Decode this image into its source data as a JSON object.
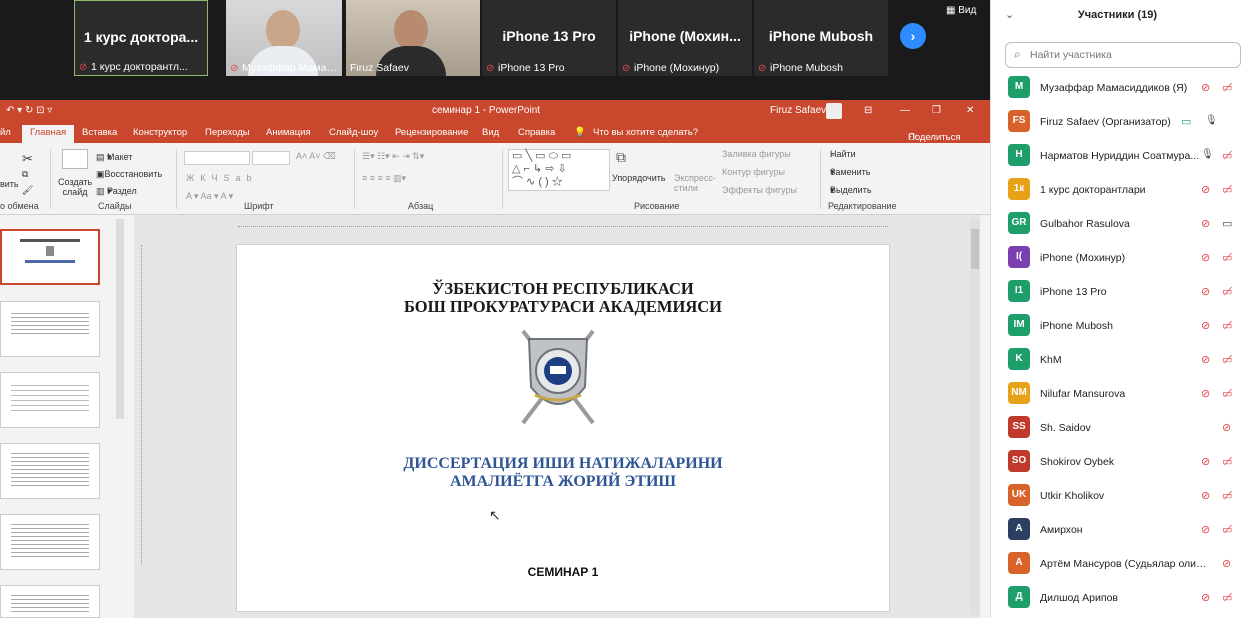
{
  "video_tiles": [
    {
      "big": "1 курс доктора...",
      "caption": "1 курс докторантл..."
    },
    {
      "big": "",
      "caption": "Музаффар Мамасидд..."
    },
    {
      "big": "",
      "caption": "Firuz Safaev"
    },
    {
      "big": "iPhone 13 Pro",
      "caption": "iPhone 13 Pro"
    },
    {
      "big": "iPhone (Мохин...",
      "caption": "iPhone (Мохинур)"
    },
    {
      "big": "iPhone Mubosh",
      "caption": "iPhone Mubosh"
    }
  ],
  "view_label": "Вид",
  "ppt": {
    "title": "семинар 1 - PowerPoint",
    "user": "Firuz Safaev",
    "tabs": [
      "йл",
      "Главная",
      "Вставка",
      "Конструктор",
      "Переходы",
      "Анимация",
      "Слайд-шоу",
      "Рецензирование",
      "Вид",
      "Справка",
      "Что вы хотите сделать?"
    ],
    "share": "Поделиться",
    "ribbon": {
      "maket": "Макет",
      "vosst": "Восстановить",
      "razdel": "Раздел",
      "create": "Создать слайд",
      "arrange": "Упорядочить",
      "express": "Экспресс-стили",
      "fill": "Заливка фигуры",
      "outline": "Контур фигуры",
      "effects": "Эффекты фигуры",
      "find": "Найти",
      "replace": "Заменить",
      "select": "Выделить",
      "vit": "вить",
      "groups": [
        "о обмена",
        "Слайды",
        "Шрифт",
        "Абзац",
        "Рисование",
        "Редактирование"
      ]
    },
    "slide": {
      "line1": "ЎЗБЕКИСТОН РЕСПУБЛИКАСИ",
      "line2": "БОШ ПРОКУРАТУРАСИ АКАДЕМИЯСИ",
      "blue1": "ДИССЕРТАЦИЯ ИШИ НАТИЖАЛАРИНИ",
      "blue2": "АМАЛИЁТГА ЖОРИЙ ЭТИШ",
      "seminar": "СЕМИНАР 1"
    }
  },
  "participants": {
    "title": "Участники (19)",
    "search_placeholder": "Найти участника",
    "list": [
      {
        "initials": "M",
        "name": "Музаффар Мамасиддиков (Я)",
        "color": "#1d9e6a"
      },
      {
        "initials": "FS",
        "name": "Firuz Safaev (Организатор)",
        "color": "#d9622b"
      },
      {
        "initials": "H",
        "name": "Нарматов Нуриддин Соатмура...",
        "color": "#1d9e6a"
      },
      {
        "initials": "1к",
        "name": "1 курс докторантлари",
        "color": "#e8a21a"
      },
      {
        "initials": "GR",
        "name": "Gulbahor Rasulova",
        "color": "#1d9e6a"
      },
      {
        "initials": "I(",
        "name": "iPhone (Мохинур)",
        "color": "#7a3fb0"
      },
      {
        "initials": "I1",
        "name": "iPhone 13 Pro",
        "color": "#1d9e6a"
      },
      {
        "initials": "IM",
        "name": "iPhone Mubosh",
        "color": "#1d9e6a"
      },
      {
        "initials": "K",
        "name": "KhM",
        "color": "#1d9e6a"
      },
      {
        "initials": "NM",
        "name": "Nilufar Mansurova",
        "color": "#e8a21a"
      },
      {
        "initials": "SS",
        "name": "Sh. Saidov",
        "color": "#c0392b"
      },
      {
        "initials": "SO",
        "name": "Shokirov Oybek",
        "color": "#c0392b"
      },
      {
        "initials": "UK",
        "name": "Utkir Kholikov",
        "color": "#d9622b"
      },
      {
        "initials": "A",
        "name": "Амирхон",
        "color": "#2c3e62"
      },
      {
        "initials": "A",
        "name": "Артём Мансуров (Судьялар олий ма...",
        "color": "#d9622b"
      },
      {
        "initials": "Д",
        "name": "Дилшод Арипов",
        "color": "#1d9e6a"
      }
    ]
  }
}
